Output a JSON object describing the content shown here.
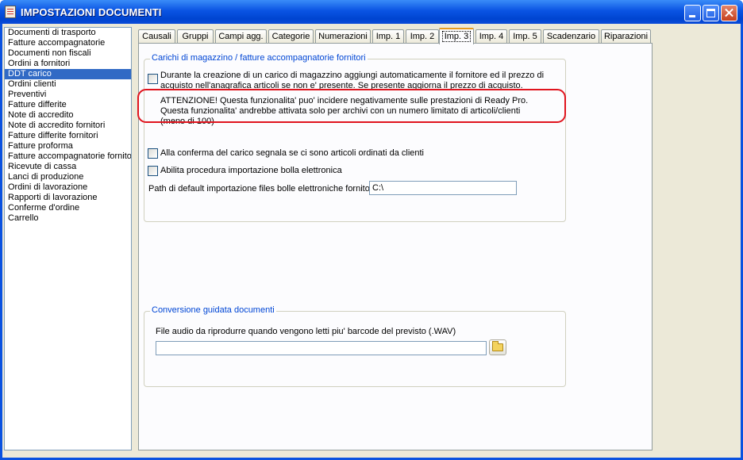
{
  "window": {
    "title": "IMPOSTAZIONI DOCUMENTI"
  },
  "sidebar": {
    "items": [
      "Documenti di trasporto",
      "Fatture accompagnatorie",
      "Documenti non fiscali",
      "Ordini a fornitori",
      "DDT carico",
      "Ordini clienti",
      "Preventivi",
      "Fatture differite",
      "Note di accredito",
      "Note di accredito fornitori",
      "Fatture differite fornitori",
      "Fatture proforma",
      "Fatture accompagnatorie fornitori",
      "Ricevute di cassa",
      "Lanci di produzione",
      "Ordini di lavorazione",
      "Rapporti di lavorazione",
      "Conferme d'ordine",
      "Carrello"
    ],
    "selected": "DDT carico"
  },
  "tabs": [
    "Causali",
    "Gruppi",
    "Campi agg.",
    "Categorie",
    "Numerazioni",
    "Imp. 1",
    "Imp. 2",
    "Imp. 3",
    "Imp. 4",
    "Imp. 5",
    "Scadenzario",
    "Riparazioni"
  ],
  "active_tab": "Imp. 3",
  "group1": {
    "label": "Carichi di magazzino / fatture accompagnatorie fornitori",
    "opt1_line1": "Durante la creazione di un carico di magazzino aggiungi automaticamente il fornitore ed il prezzo di",
    "opt1_line2": "acquisto nell'anagrafica articoli se non e' presente. Se presente aggiorna il prezzo di acquisto.",
    "warn_line1": "ATTENZIONE! Questa funzionalita' puo' incidere negativamente sulle prestazioni di Ready Pro.",
    "warn_line2": "Questa funzionalita' andrebbe attivata solo per archivi con un numero limitato di articoli/clienti",
    "warn_line3": "(meno di 100)",
    "opt2_label": "Alla conferma del carico segnala se ci sono articoli ordinati da clienti",
    "opt3_label": "Abilita procedura importazione bolla elettronica",
    "path_label": "Path di default importazione files bolle elettroniche fornitori",
    "path_value": "C:\\"
  },
  "group2": {
    "label": "Conversione guidata documenti",
    "audio_label": "File audio da riprodurre quando vengono letti piu' barcode del previsto  (.WAV)",
    "audio_value": ""
  },
  "colors": {
    "titlebar": "#0a54e3",
    "selection": "#316ac5",
    "group_label": "#0046d5",
    "highlight_box": "#e0141e",
    "active_tab_top": "#e69c1e"
  }
}
